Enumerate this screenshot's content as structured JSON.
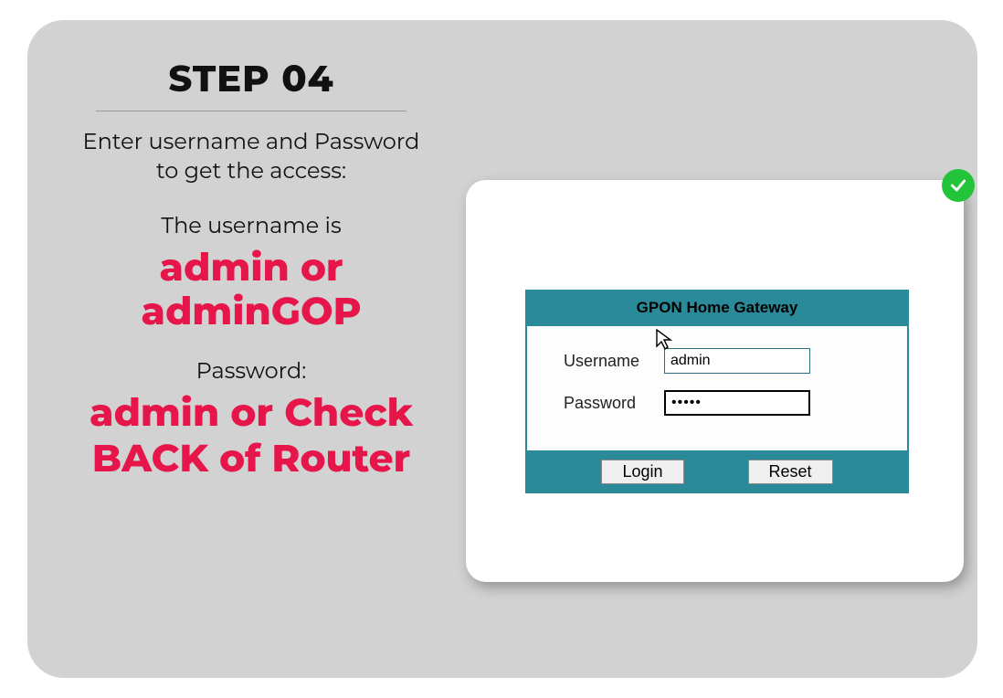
{
  "step": {
    "title": "STEP 04",
    "intro": "Enter username and Pass­word to get the access:",
    "username_label": "The username is",
    "username_value": "admin or adminGOP",
    "password_label": "Password:",
    "password_value": "admin or Check BACK of Router"
  },
  "router": {
    "header": "GPON Home Gateway",
    "username_label": "Username",
    "username_value": "admin",
    "password_label": "Password",
    "password_value": "•••••",
    "login_label": "Login",
    "reset_label": "Reset"
  },
  "icons": {
    "check": "check-icon",
    "cursor": "cursor-icon"
  }
}
